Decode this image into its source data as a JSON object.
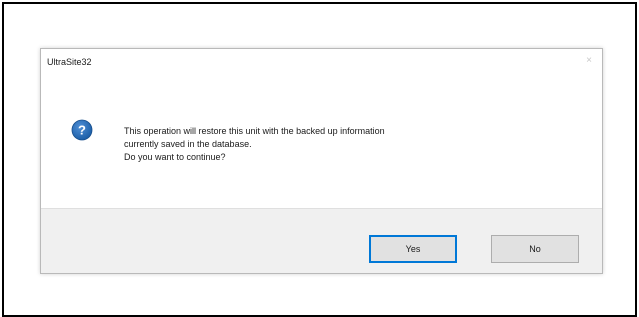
{
  "window": {
    "title": "UltraSite32",
    "close_glyph": "×"
  },
  "message": {
    "line1": "This operation will restore this unit with the backed up information",
    "line2": "currently saved in the database.",
    "line3": "Do you want to continue?"
  },
  "icon": {
    "name": "question-icon",
    "glyph": "?",
    "color": "#1c5fa8"
  },
  "buttons": {
    "yes_label": "Yes",
    "no_label": "No"
  },
  "colors": {
    "focus_border": "#0078d7",
    "footer_bg": "#f0f0f0",
    "frame_border": "#000000"
  }
}
